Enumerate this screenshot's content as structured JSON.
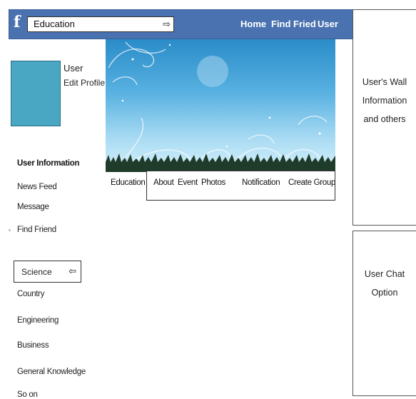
{
  "header": {
    "logo": "f",
    "search_value": "Education",
    "nav": [
      "Home",
      "Find Fried",
      "User"
    ]
  },
  "profile": {
    "name": "User",
    "edit": "Edit Profile"
  },
  "profile_tabs": [
    "Education",
    "About",
    "Event",
    "Photos",
    "Notification",
    "Create Group"
  ],
  "sidebar": {
    "heading": "User Information",
    "links": [
      "News Feed",
      "Message",
      "Find Friend"
    ],
    "category_value": "Science",
    "categories": [
      "Country",
      "Engineering",
      "Business",
      "General Knowledge",
      "So on"
    ]
  },
  "panels": {
    "wall": "User's Wall\nInformation\nand others",
    "chat": "User Chat\nOption"
  },
  "icons": {
    "search_arrow": "arrow-icon",
    "category_arrow": "arrow-icon"
  },
  "colors": {
    "header_bg": "#4a72b0",
    "avatar": "#4aa7c3",
    "cover_sky": "#58b1e1"
  }
}
